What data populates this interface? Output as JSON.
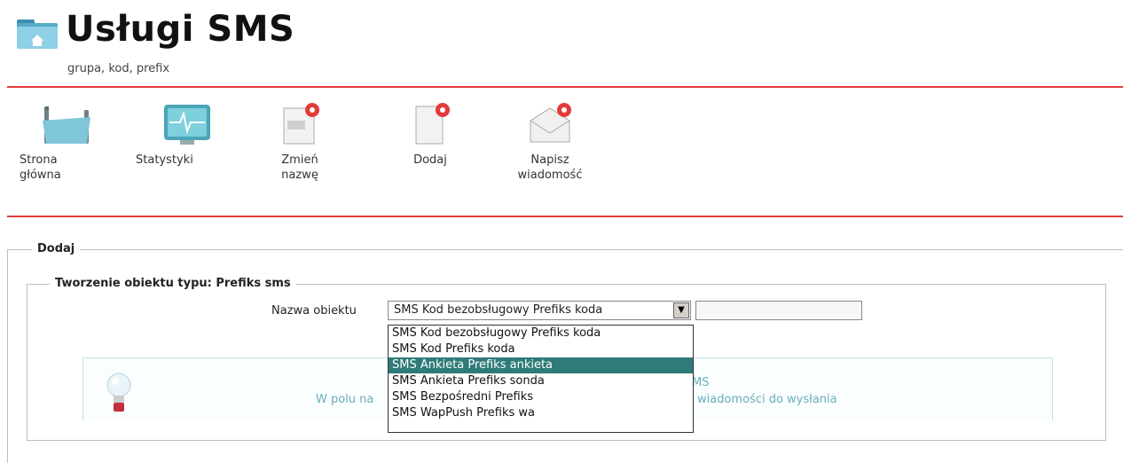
{
  "header": {
    "title": "Usługi SMS",
    "subtitle": "grupa, kod, prefix"
  },
  "toolbar": [
    {
      "label": "Strona główna",
      "icon": "folder-icon"
    },
    {
      "label": "Statystyki",
      "icon": "monitor-icon"
    },
    {
      "label": "Zmień nazwę",
      "icon": "rename-icon"
    },
    {
      "label": "Dodaj",
      "icon": "add-page-icon"
    },
    {
      "label": "Napisz wiadomość",
      "icon": "envelope-icon"
    }
  ],
  "form": {
    "outer_legend": "Dodaj",
    "inner_legend": "Tworzenie obiektu typu: Prefiks sms",
    "field_label": "Nazwa obiektu",
    "select_value": "SMS Kod bezobsługowy Prefiks koda",
    "text_value": ""
  },
  "dropdown": {
    "options": [
      "SMS Kod bezobsługowy Prefiks koda",
      "SMS Kod Prefiks koda",
      "SMS Ankieta Prefiks ankieta",
      "SMS Ankieta Prefiks sonda",
      "SMS Bezpośredni Prefiks",
      "SMS WapPush Prefiks wa"
    ],
    "selected_index": 2
  },
  "info": {
    "line1": "MS",
    "line2_left": "W polu na",
    "line2_right": "wiadomości do wysłania"
  },
  "colors": {
    "accent_red": "#e23a3a",
    "selected_bg": "#2e7b79",
    "info_text": "#6aaebb"
  }
}
